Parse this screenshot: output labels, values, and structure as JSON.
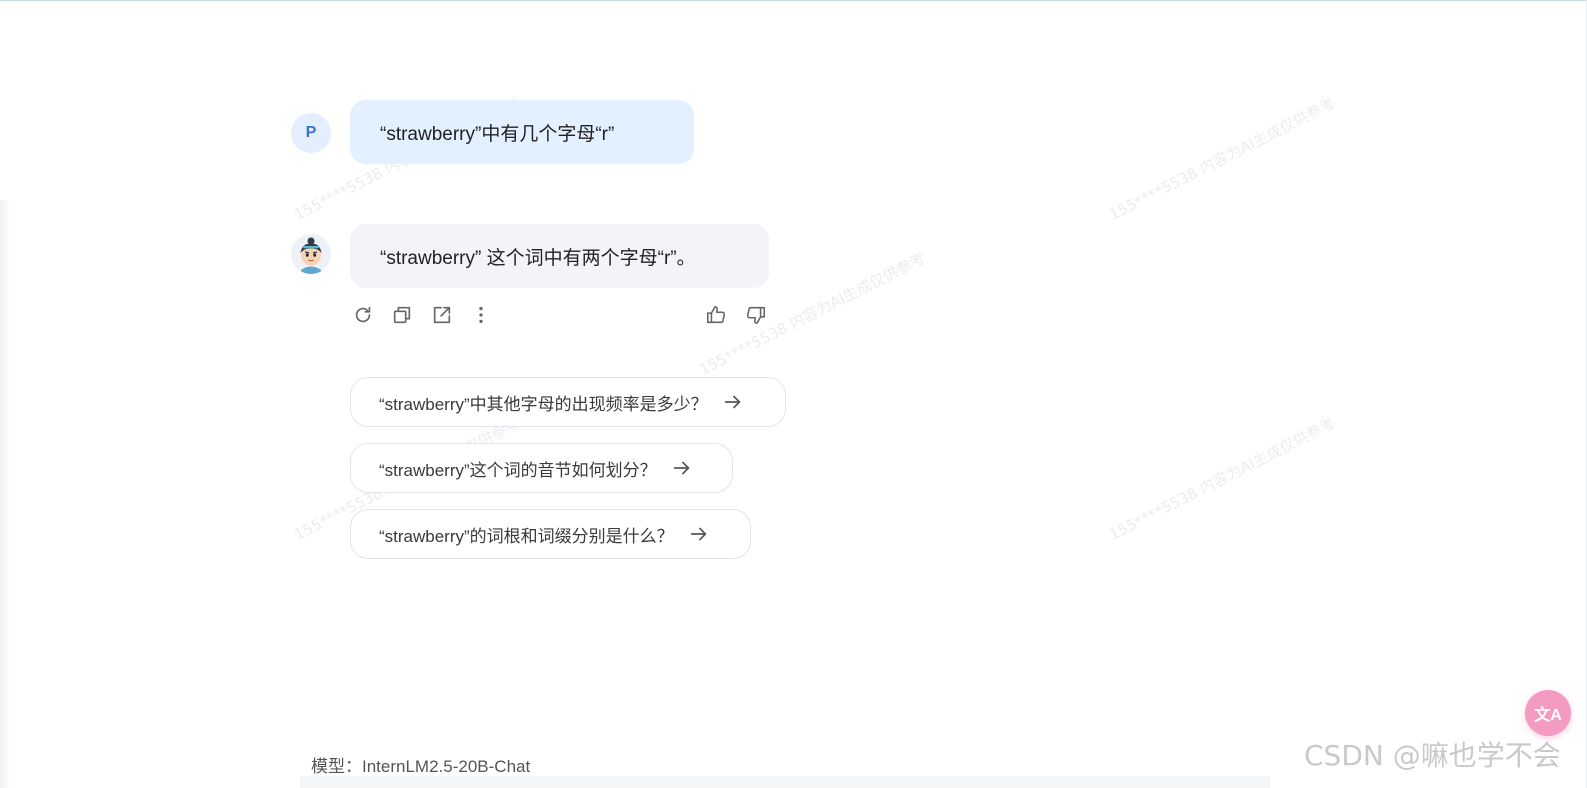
{
  "conversation": {
    "user": {
      "avatar_letter": "P",
      "message": "“strawberry”中有几个字母“r”"
    },
    "assistant": {
      "avatar_icon": "bot-character-avatar",
      "message": "“strawberry” 这个词中有两个字母“r”。"
    }
  },
  "message_actions": {
    "left": [
      "regenerate-icon",
      "copy-icon",
      "share-icon",
      "more-icon"
    ],
    "right": [
      "thumbs-up-icon",
      "thumbs-down-icon"
    ]
  },
  "suggestions": [
    {
      "text": "“strawberry”中其他字母的出现频率是多少？"
    },
    {
      "text": "“strawberry”这个词的音节如何划分？"
    },
    {
      "text": "“strawberry”的词根和词缀分别是什么？"
    }
  ],
  "footer": {
    "model_label": "模型：InternLM2.5-20B-Chat"
  },
  "translate_button": {
    "label": "文A",
    "color": "#f39bc1"
  },
  "overlay": {
    "csdn_watermark": "CSDN @嘛也学不会",
    "page_watermark": "155****5538 内容为AI生成仅供参考"
  },
  "colors": {
    "user_bubble": "#e3f0ff",
    "assistant_bubble": "#f3f4f7",
    "user_avatar_text": "#3a73d6"
  }
}
